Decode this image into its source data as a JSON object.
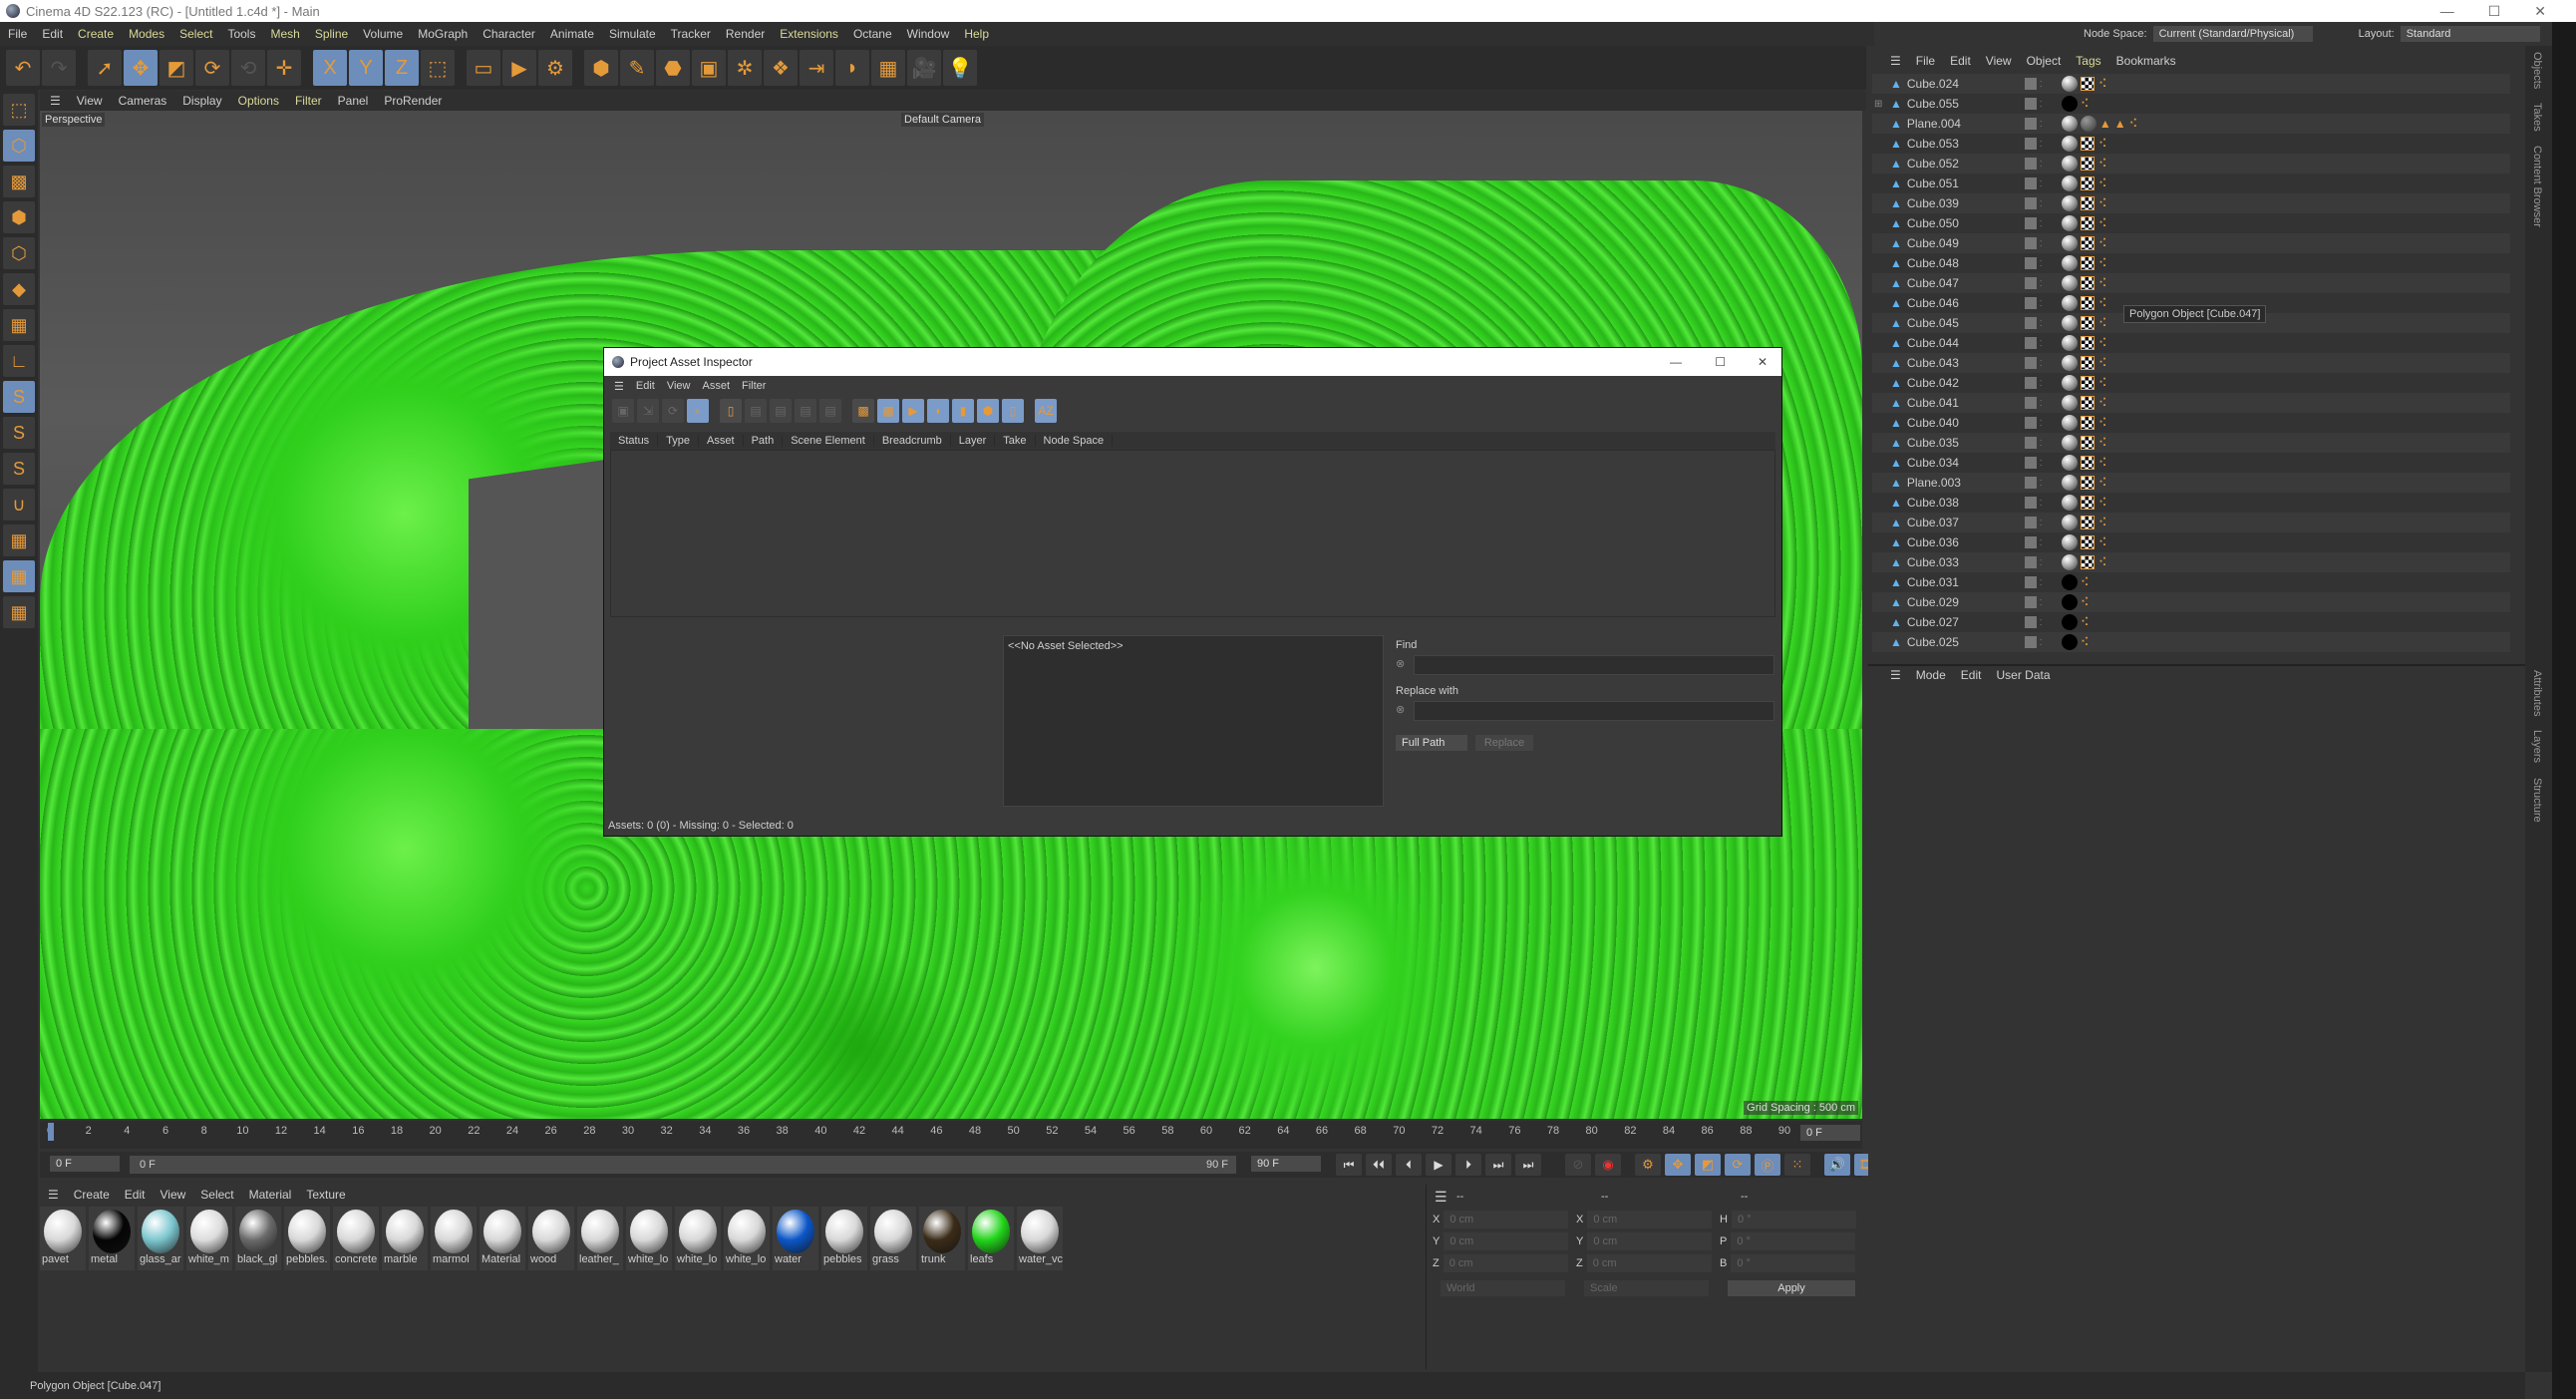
{
  "window": {
    "title": "Cinema 4D S22.123 (RC) - [Untitled 1.c4d *] - Main",
    "controls": [
      "—",
      "☐",
      "✕"
    ]
  },
  "menu": [
    {
      "label": "File"
    },
    {
      "label": "Edit"
    },
    {
      "label": "Create",
      "hl": true
    },
    {
      "label": "Modes",
      "hl": true
    },
    {
      "label": "Select",
      "hl": true
    },
    {
      "label": "Tools"
    },
    {
      "label": "Mesh",
      "hl": true
    },
    {
      "label": "Spline",
      "hl": true
    },
    {
      "label": "Volume"
    },
    {
      "label": "MoGraph"
    },
    {
      "label": "Character"
    },
    {
      "label": "Animate"
    },
    {
      "label": "Simulate"
    },
    {
      "label": "Tracker"
    },
    {
      "label": "Render"
    },
    {
      "label": "Extensions",
      "hl": true
    },
    {
      "label": "Octane"
    },
    {
      "label": "Window"
    },
    {
      "label": "Help",
      "hl": true
    }
  ],
  "toolbar": [
    {
      "icon": "undo-icon",
      "g": "↶",
      "off": false
    },
    {
      "icon": "redo-icon",
      "g": "↷",
      "off": true
    },
    {
      "gap": true
    },
    {
      "icon": "select-icon",
      "g": "➚"
    },
    {
      "icon": "move-icon",
      "g": "✥",
      "sel": true
    },
    {
      "icon": "scale-icon",
      "g": "◩"
    },
    {
      "icon": "rotate-icon",
      "g": "⟳"
    },
    {
      "icon": "psr-icon",
      "g": "⟲",
      "off": true
    },
    {
      "icon": "move-tool-icon",
      "g": "✛"
    },
    {
      "gap": true
    },
    {
      "icon": "x-axis-icon",
      "g": "X",
      "sel": true
    },
    {
      "icon": "y-axis-icon",
      "g": "Y",
      "sel": true
    },
    {
      "icon": "z-axis-icon",
      "g": "Z",
      "sel": true
    },
    {
      "icon": "coordinate-system-icon",
      "g": "⬚"
    },
    {
      "gap": true
    },
    {
      "icon": "render-region-icon",
      "g": "▭"
    },
    {
      "icon": "render-view-icon",
      "g": "▶"
    },
    {
      "icon": "render-settings-icon",
      "g": "⚙"
    },
    {
      "gap": true
    },
    {
      "icon": "cube-icon",
      "g": "⬢"
    },
    {
      "icon": "pen-icon",
      "g": "✎"
    },
    {
      "icon": "subdivision-icon",
      "g": "⬣"
    },
    {
      "icon": "extrude-icon",
      "g": "▣"
    },
    {
      "icon": "cloner-icon",
      "g": "✲"
    },
    {
      "icon": "mograph-icon",
      "g": "❖"
    },
    {
      "icon": "deformer-icon",
      "g": "⇥"
    },
    {
      "icon": "field-icon",
      "g": "◗"
    },
    {
      "icon": "floor-icon",
      "g": "▦"
    },
    {
      "icon": "camera-icon",
      "g": "🎥"
    },
    {
      "icon": "light-icon",
      "g": "💡"
    }
  ],
  "viewport": {
    "menu": [
      {
        "label": "View"
      },
      {
        "label": "Cameras"
      },
      {
        "label": "Display"
      },
      {
        "label": "Options",
        "hl": true
      },
      {
        "label": "Filter",
        "hl": true
      },
      {
        "label": "Panel"
      },
      {
        "label": "ProRender"
      }
    ],
    "view_name": "Perspective",
    "camera": "Default Camera",
    "grid_spacing": "Grid Spacing : 500 cm"
  },
  "left_tools": [
    {
      "icon": "make-editable-icon",
      "g": "⬚"
    },
    {
      "icon": "model-mode-icon",
      "g": "⬡",
      "sel": true
    },
    {
      "icon": "texture-mode-icon",
      "g": "▩"
    },
    {
      "icon": "points-mode-icon",
      "g": "⬢"
    },
    {
      "icon": "edges-mode-icon",
      "g": "⬡"
    },
    {
      "icon": "polygons-mode-icon",
      "g": "◆"
    },
    {
      "icon": "uv-mode-icon",
      "g": "▦"
    },
    {
      "icon": "axis-mode-icon",
      "g": "∟"
    },
    {
      "icon": "solo-icon",
      "g": "S",
      "sel": true
    },
    {
      "icon": "solo-hierarchy-icon",
      "g": "S"
    },
    {
      "icon": "solo-off-icon",
      "g": "S"
    },
    {
      "icon": "snap-icon",
      "g": "∪"
    },
    {
      "icon": "workplane-icon",
      "g": "▦"
    },
    {
      "icon": "lock-workplane-icon",
      "g": "▦",
      "sel": true
    },
    {
      "icon": "workplane-align-icon",
      "g": "▦"
    }
  ],
  "timeline": {
    "ticks": [
      "0",
      "2",
      "4",
      "6",
      "8",
      "10",
      "12",
      "14",
      "16",
      "18",
      "20",
      "22",
      "24",
      "26",
      "28",
      "30",
      "32",
      "34",
      "36",
      "38",
      "40",
      "42",
      "44",
      "46",
      "48",
      "50",
      "52",
      "54",
      "56",
      "58",
      "60",
      "62",
      "64",
      "66",
      "68",
      "70",
      "72",
      "74",
      "76",
      "78",
      "80",
      "82",
      "84",
      "86",
      "88",
      "90"
    ],
    "current_frame": "0 F",
    "start": "0 F",
    "range_start": "0 F",
    "range_end": "90 F",
    "end": "90 F",
    "playhead_frame": 0
  },
  "transport": [
    "⏮",
    "⏴⏴",
    "⏴",
    "▶",
    "⏵",
    "⏭",
    "⏭"
  ],
  "materials": {
    "menu": [
      "Create",
      "Edit",
      "View",
      "Select",
      "Material",
      "Texture"
    ],
    "items": [
      {
        "name": "pavet",
        "color": "#d8d8d8"
      },
      {
        "name": "metal",
        "color": "#050505"
      },
      {
        "name": "glass_ar",
        "color": "#7cc6cf"
      },
      {
        "name": "white_m",
        "color": "#dcdcdc"
      },
      {
        "name": "black_gl",
        "color": "#6a6a6a"
      },
      {
        "name": "pebbles.",
        "color": "#d8d8d8"
      },
      {
        "name": "concrete",
        "color": "#d8d8d8"
      },
      {
        "name": "marble",
        "color": "#d8d8d8"
      },
      {
        "name": "marmol",
        "color": "#d8d8d8"
      },
      {
        "name": "Material",
        "color": "#d8d8d8"
      },
      {
        "name": "wood",
        "color": "#d8d8d8"
      },
      {
        "name": "leather_",
        "color": "#d8d8d8"
      },
      {
        "name": "white_lo",
        "color": "#d8d8d8"
      },
      {
        "name": "white_lo",
        "color": "#d8d8d8"
      },
      {
        "name": "white_lo",
        "color": "#d8d8d8"
      },
      {
        "name": "water",
        "color": "#0b56c8"
      },
      {
        "name": "pebbles",
        "color": "#d8d8d8"
      },
      {
        "name": "grass",
        "color": "#d8d8d8"
      },
      {
        "name": "trunk",
        "color": "#3b2c18"
      },
      {
        "name": "leafs",
        "color": "#22d41a"
      },
      {
        "name": "water_vc",
        "color": "#d8d8d8"
      }
    ]
  },
  "coords": {
    "headers": [
      "--",
      "--",
      "--"
    ],
    "rows": [
      [
        "X",
        "0 cm",
        "X",
        "0 cm",
        "H",
        "0 °"
      ],
      [
        "Y",
        "0 cm",
        "Y",
        "0 cm",
        "P",
        "0 °"
      ],
      [
        "Z",
        "0 cm",
        "Z",
        "0 cm",
        "B",
        "0 °"
      ]
    ],
    "mode1": "World",
    "mode2": "Scale",
    "apply": "Apply"
  },
  "node_space": {
    "label": "Node Space:",
    "value": "Current (Standard/Physical)",
    "layout_label": "Layout:",
    "layout_value": "Standard"
  },
  "objects": {
    "menu": [
      {
        "label": "File"
      },
      {
        "label": "Edit"
      },
      {
        "label": "View"
      },
      {
        "label": "Object"
      },
      {
        "label": "Tags",
        "hl": true
      },
      {
        "label": "Bookmarks"
      }
    ],
    "rows": [
      {
        "name": "Cube.024",
        "tags": "std"
      },
      {
        "name": "Cube.055",
        "tags": "black",
        "expand": true
      },
      {
        "name": "Plane.004",
        "tags": "plane"
      },
      {
        "name": "Cube.053",
        "tags": "std"
      },
      {
        "name": "Cube.052",
        "tags": "std"
      },
      {
        "name": "Cube.051",
        "tags": "std"
      },
      {
        "name": "Cube.039",
        "tags": "std"
      },
      {
        "name": "Cube.050",
        "tags": "std"
      },
      {
        "name": "Cube.049",
        "tags": "std"
      },
      {
        "name": "Cube.048",
        "tags": "std"
      },
      {
        "name": "Cube.047",
        "tags": "std"
      },
      {
        "name": "Cube.046",
        "tags": "std"
      },
      {
        "name": "Cube.045",
        "tags": "std"
      },
      {
        "name": "Cube.044",
        "tags": "std"
      },
      {
        "name": "Cube.043",
        "tags": "std"
      },
      {
        "name": "Cube.042",
        "tags": "std"
      },
      {
        "name": "Cube.041",
        "tags": "std"
      },
      {
        "name": "Cube.040",
        "tags": "std"
      },
      {
        "name": "Cube.035",
        "tags": "std"
      },
      {
        "name": "Cube.034",
        "tags": "std"
      },
      {
        "name": "Plane.003",
        "tags": "std"
      },
      {
        "name": "Cube.038",
        "tags": "std"
      },
      {
        "name": "Cube.037",
        "tags": "std"
      },
      {
        "name": "Cube.036",
        "tags": "std"
      },
      {
        "name": "Cube.033",
        "tags": "std"
      },
      {
        "name": "Cube.031",
        "tags": "blackmat"
      },
      {
        "name": "Cube.029",
        "tags": "blackmat"
      },
      {
        "name": "Cube.027",
        "tags": "blackmat"
      },
      {
        "name": "Cube.025",
        "tags": "blackmat"
      }
    ],
    "tooltip": "Polygon Object [Cube.047]"
  },
  "attributes": {
    "menu": [
      "Mode",
      "Edit",
      "User Data"
    ]
  },
  "side_tabs_top": [
    "Objects",
    "Takes",
    "Content Browser"
  ],
  "side_tabs_bottom": [
    "Attributes",
    "Layers",
    "Structure"
  ],
  "dialog": {
    "title": "Project Asset Inspector",
    "menu": [
      "Edit",
      "View",
      "Asset",
      "Filter"
    ],
    "tools": [
      {
        "g": "▣",
        "off": true
      },
      {
        "g": "⇲",
        "off": true
      },
      {
        "g": "⟳",
        "off": true
      },
      {
        "g": "⌕",
        "sel": true
      },
      {
        "g": "▯"
      },
      {
        "g": "▤",
        "off": true
      },
      {
        "g": "▤",
        "off": true
      },
      {
        "g": "▤",
        "off": true
      },
      {
        "g": "▤",
        "off": true
      },
      {
        "g": "▩"
      },
      {
        "g": "▩",
        "sel": true
      },
      {
        "g": "▶",
        "sel": true
      },
      {
        "g": "◗",
        "sel": true
      },
      {
        "g": "▮",
        "sel": true
      },
      {
        "g": "⬢",
        "sel": true
      },
      {
        "g": "▯",
        "sel": true
      },
      {
        "g": "AZ",
        "sel": true
      }
    ],
    "columns": [
      "Status",
      "Type",
      "Asset",
      "Path",
      "Scene Element",
      "Breadcrumb",
      "Layer",
      "Take",
      "Node Space"
    ],
    "preview": "<<No Asset Selected>>",
    "find_label": "Find",
    "find_value": "",
    "replace_label": "Replace with",
    "replace_value": "",
    "path_mode": "Full Path",
    "replace_button": "Replace",
    "status": "Assets: 0 (0) - Missing: 0 - Selected: 0"
  },
  "status_bar": "Polygon Object [Cube.047]"
}
